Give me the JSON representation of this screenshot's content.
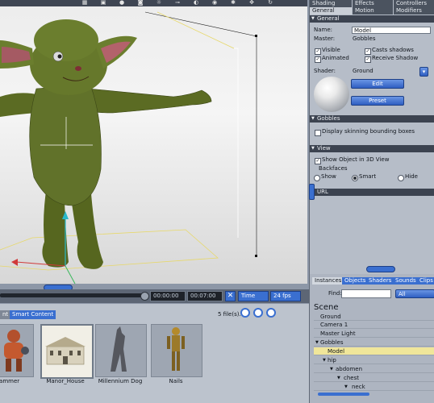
{
  "viewport": {
    "toolbar_icons": [
      "grid-icon",
      "cube-icon",
      "sphere-icon",
      "camera-icon",
      "light-icon",
      "bone-icon",
      "paint-icon",
      "eye-icon",
      "gear-icon",
      "move-icon",
      "rotate-icon"
    ]
  },
  "timeline": {
    "current_time": "00:00:00",
    "end_time": "00:07:00",
    "mode": "Time",
    "fps": "24 fps"
  },
  "library": {
    "tabs": [
      "nt",
      "Smart Content"
    ],
    "file_count": "5 file(s).",
    "items": [
      {
        "label": "Hammer",
        "icon": "robot-figure-icon"
      },
      {
        "label": "Manor_House",
        "icon": "house-icon"
      },
      {
        "label": "Millennium Dog",
        "icon": "dog-figure-icon"
      },
      {
        "label": "Nails",
        "icon": "nails-figure-icon"
      }
    ]
  },
  "properties": {
    "top_tabs": [
      "Shading",
      "Effects",
      "Controllers"
    ],
    "main_tabs": [
      "General",
      "Motion",
      "Modifiers"
    ],
    "general": {
      "header": "General",
      "name_label": "Name:",
      "name_value": "Model",
      "master_label": "Master:",
      "master_value": "Gobbles",
      "visible": "Visible",
      "casts_shadows": "Casts shadows",
      "animated": "Animated",
      "receive_shadow": "Receive Shadow",
      "shader_label": "Shader:",
      "shader_value": "Ground",
      "edit_button": "Edit",
      "preset_button": "Preset"
    },
    "gobbles": {
      "header": "Gobbles",
      "skinning": "Display skinning bounding boxes"
    },
    "view": {
      "header": "View",
      "show_in_3d": "Show Object in 3D View",
      "backfaces": "Backfaces",
      "show": "Show",
      "smart": "Smart",
      "hide": "Hide"
    },
    "url": {
      "header": "URL"
    }
  },
  "scene": {
    "tabs": [
      "Instances",
      "Objects",
      "Shaders",
      "Sounds",
      "Clips"
    ],
    "find_label": "Find:",
    "filter": "All",
    "title": "Scene",
    "tree": [
      {
        "label": "Ground"
      },
      {
        "label": "Camera 1"
      },
      {
        "label": "Master Light"
      },
      {
        "label": "Gobbles"
      },
      {
        "label": "Model"
      },
      {
        "label": "hip"
      },
      {
        "label": "abdomen"
      },
      {
        "label": "chest"
      },
      {
        "label": "neck"
      }
    ]
  }
}
